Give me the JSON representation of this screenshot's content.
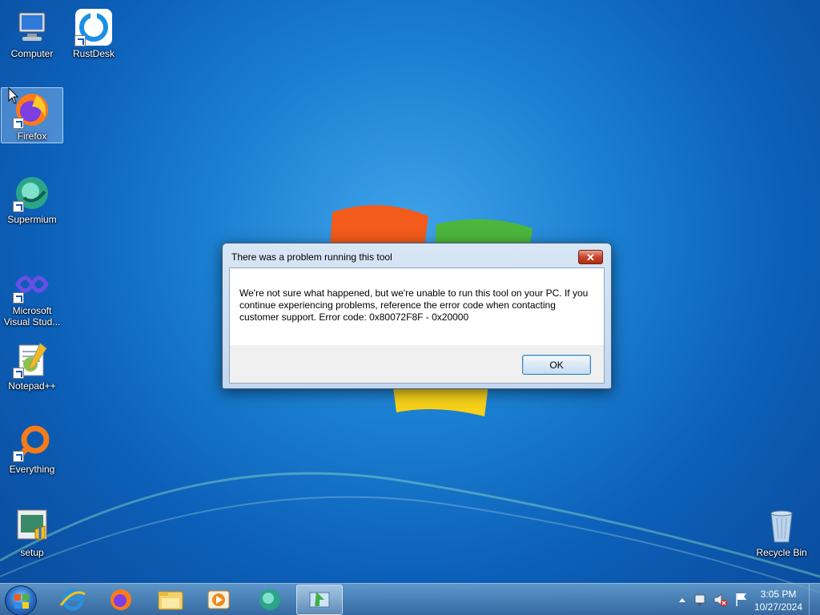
{
  "desktop": {
    "icons": [
      {
        "label": "Computer"
      },
      {
        "label": "RustDesk"
      },
      {
        "label": "Firefox"
      },
      {
        "label": "Supermium"
      },
      {
        "label": "Microsoft Visual Stud..."
      },
      {
        "label": "Notepad++"
      },
      {
        "label": "Everything"
      },
      {
        "label": "setup"
      },
      {
        "label": "Recycle Bin"
      }
    ]
  },
  "dialog": {
    "title": "There was a problem running this tool",
    "close_label": "✕",
    "message": "We're not sure what happened, but we're unable to run this tool on your PC. If you continue experiencing problems, reference the error code when contacting customer support. Error code: 0x80072F8F - 0x20000",
    "ok_label": "OK"
  },
  "taskbar": {
    "pinned": [
      "start-icon",
      "internet-explorer-icon",
      "firefox-icon",
      "file-explorer-icon",
      "media-player-icon",
      "supermium-icon",
      "media-creation-tool-icon"
    ],
    "clock": {
      "time": "3:05 PM",
      "date": "10/27/2024"
    }
  },
  "colors": {
    "accent": "#1a7fd1",
    "close": "#c8452d"
  }
}
